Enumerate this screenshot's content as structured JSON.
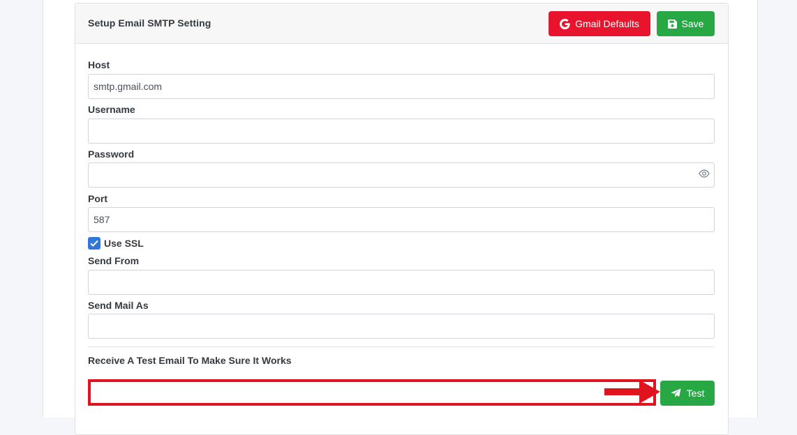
{
  "card": {
    "title": "Setup Email SMTP Setting",
    "gmail_defaults_label": "Gmail Defaults",
    "save_label": "Save"
  },
  "form": {
    "host": {
      "label": "Host",
      "value": "smtp.gmail.com"
    },
    "username": {
      "label": "Username",
      "value": ""
    },
    "password": {
      "label": "Password",
      "value": ""
    },
    "port": {
      "label": "Port",
      "value": "587"
    },
    "use_ssl": {
      "label": "Use SSL",
      "checked": true
    },
    "send_from": {
      "label": "Send From",
      "value": ""
    },
    "send_mail_as": {
      "label": "Send Mail As",
      "value": ""
    }
  },
  "test": {
    "label": "Receive A Test Email To Make Sure It Works",
    "email_value": "",
    "button_label": "Test"
  },
  "icons": {
    "gmail": "google-icon",
    "save": "floppy-disk-icon",
    "password_toggle": "eye-icon",
    "checkbox": "checkmark-icon",
    "test": "paper-plane-icon",
    "annotation": "arrow-right-icon"
  },
  "colors": {
    "gmail_button": "#e8142d",
    "save_button": "#28a745",
    "test_button": "#28a745",
    "checkbox": "#2f77d8",
    "highlight": "#e0141e"
  }
}
